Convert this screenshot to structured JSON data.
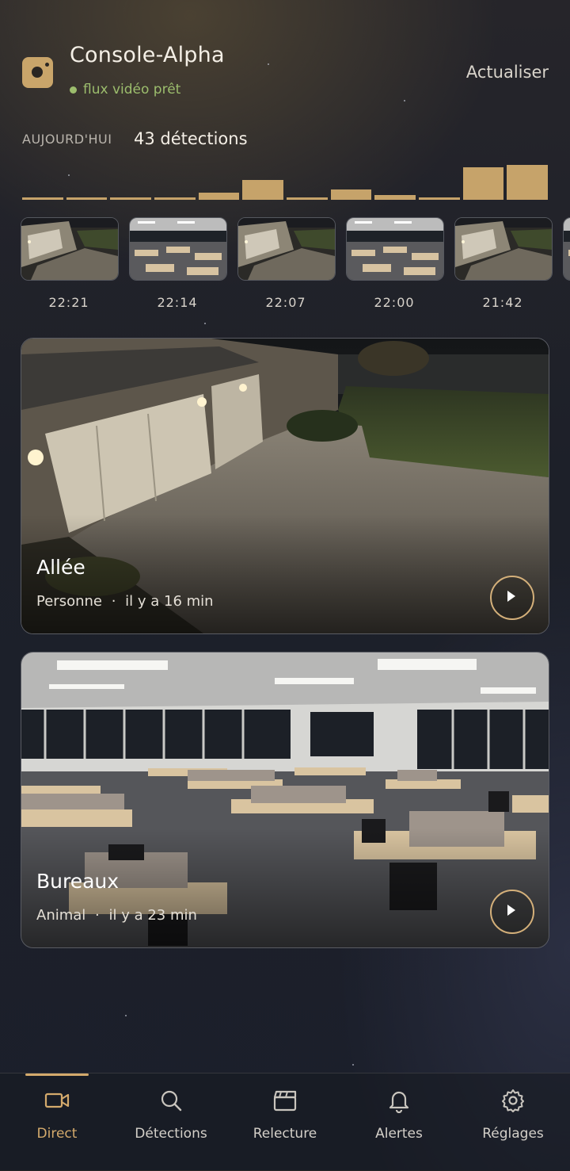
{
  "header": {
    "app_icon": "camera-icon",
    "title": "Console-Alpha",
    "status": "flux vidéo prêt",
    "status_color": "#9cbd6d",
    "refresh_label": "Actualiser"
  },
  "today": {
    "label": "AUJOURD'HUI",
    "count_text": "43 détections",
    "histogram": [
      1,
      1,
      1,
      1,
      3,
      8,
      1,
      4,
      2,
      1,
      13,
      14
    ]
  },
  "thumbnails": [
    {
      "time": "22:21",
      "scene": "driveway"
    },
    {
      "time": "22:14",
      "scene": "office"
    },
    {
      "time": "22:07",
      "scene": "driveway"
    },
    {
      "time": "22:00",
      "scene": "office"
    },
    {
      "time": "21:42",
      "scene": "driveway"
    }
  ],
  "cameras": [
    {
      "name": "Allée",
      "event": "Personne",
      "separator": "·",
      "time": "il y a 16 min",
      "scene": "driveway"
    },
    {
      "name": "Bureaux",
      "event": "Animal",
      "separator": "·",
      "time": "il y a 23 min",
      "scene": "office"
    }
  ],
  "nav": [
    {
      "label": "Direct",
      "icon": "video-icon",
      "active": true
    },
    {
      "label": "Détections",
      "icon": "search-icon",
      "active": false
    },
    {
      "label": "Relecture",
      "icon": "clapperboard-icon",
      "active": false
    },
    {
      "label": "Alertes",
      "icon": "bell-icon",
      "active": false
    },
    {
      "label": "Réglages",
      "icon": "gear-icon",
      "active": false
    }
  ],
  "colors": {
    "accent": "#d4aa6c",
    "bar": "#c6a36a",
    "status": "#9cbd6d"
  }
}
